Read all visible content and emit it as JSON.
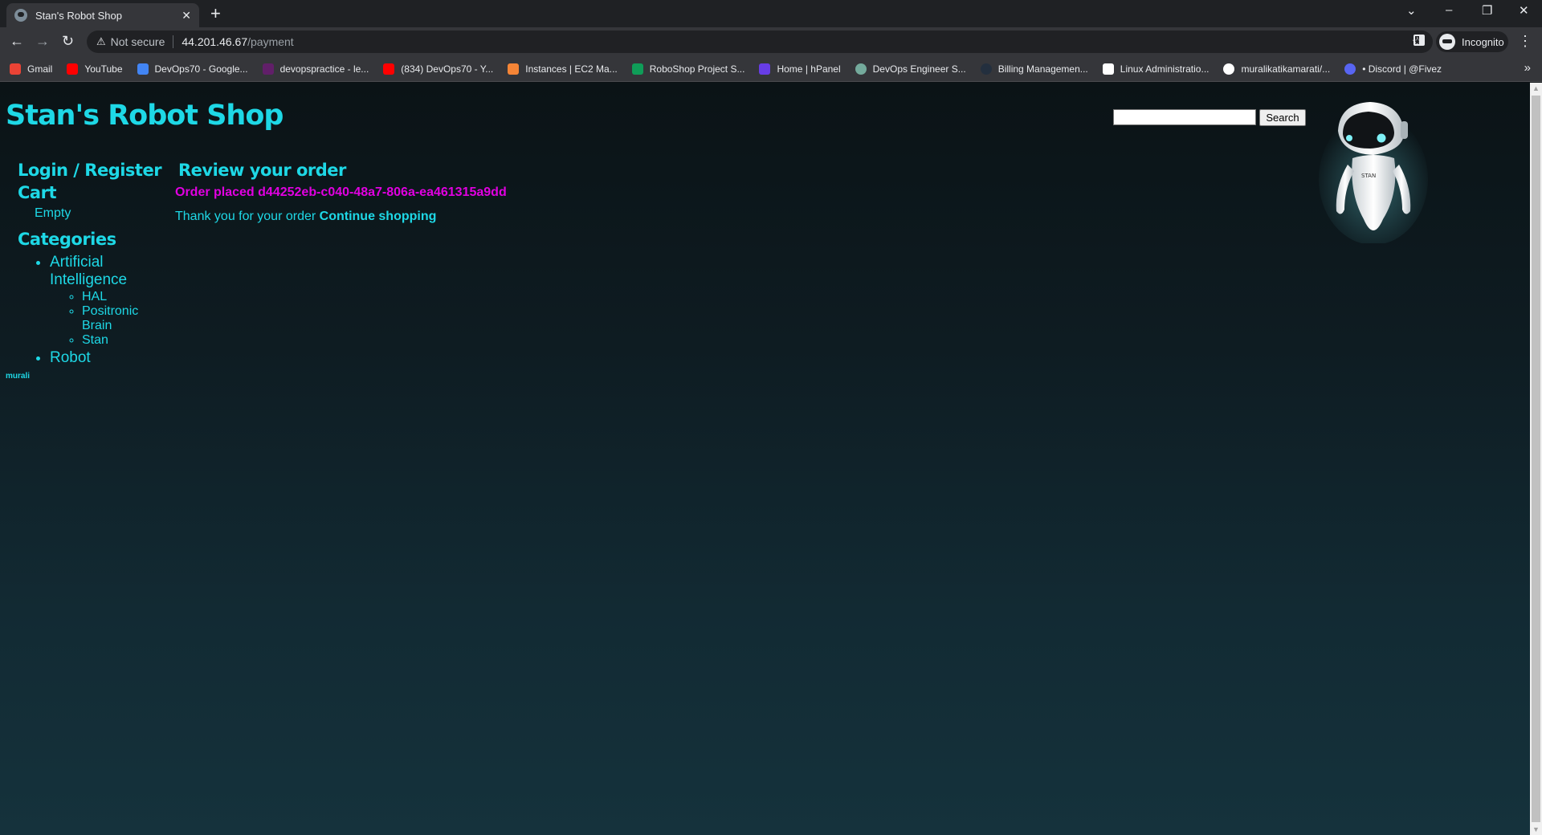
{
  "browser": {
    "tab_title": "Stan's Robot Shop",
    "tab_close": "✕",
    "new_tab": "+",
    "window_controls": [
      "⌄",
      "–",
      "❐",
      "✕"
    ],
    "nav": {
      "back": "←",
      "forward": "→",
      "reload": "↻"
    },
    "address": {
      "security_label": "Not secure",
      "host": "44.201.46.67",
      "path": "/payment"
    },
    "bookmark_star": "☆",
    "profile_label": "Incognito",
    "menu": "⋮",
    "bookmarks": [
      {
        "label": "Gmail",
        "icon": "gmail-icon",
        "color": "#ea4335"
      },
      {
        "label": "YouTube",
        "icon": "youtube-icon",
        "color": "#ff0000"
      },
      {
        "label": "DevOps70 - Google...",
        "icon": "google-docs-icon",
        "color": "#4285f4"
      },
      {
        "label": "devopspractice - le...",
        "icon": "slack-icon",
        "color": "#611f69"
      },
      {
        "label": "(834) DevOps70 - Y...",
        "icon": "youtube-icon",
        "color": "#ff0000"
      },
      {
        "label": "Instances | EC2 Ma...",
        "icon": "aws-ec2-icon",
        "color": "#f58536"
      },
      {
        "label": "RoboShop Project S...",
        "icon": "google-sheets-icon",
        "color": "#0f9d58"
      },
      {
        "label": "Home | hPanel",
        "icon": "hostinger-icon",
        "color": "#673de6"
      },
      {
        "label": "DevOps Engineer S...",
        "icon": "chatgpt-icon",
        "color": "#74aa9c"
      },
      {
        "label": "Billing Managemen...",
        "icon": "aws-icon",
        "color": "#232f3e"
      },
      {
        "label": "Linux Administratio...",
        "icon": "k-logo-icon",
        "color": "#ffffff"
      },
      {
        "label": "muralikatikamarati/...",
        "icon": "github-icon",
        "color": "#ffffff"
      },
      {
        "label": "• Discord | @Fivez",
        "icon": "discord-icon",
        "color": "#5865f2"
      }
    ],
    "bookmarks_overflow": "»"
  },
  "page": {
    "site_title": "Stan's Robot Shop",
    "search": {
      "value": "",
      "button_label": "Search"
    },
    "robot_label": "STAN",
    "sidebar": {
      "login_label": "Login / Register",
      "cart_heading": "Cart",
      "cart_status": "Empty",
      "categories_heading": "Categories",
      "categories": [
        {
          "label": "Artificial Intelligence",
          "items": [
            "HAL",
            "Positronic Brain",
            "Stan"
          ]
        },
        {
          "label": "Robot",
          "items": []
        }
      ]
    },
    "main": {
      "heading": "Review your order",
      "order_message": "Order placed d44252eb-c040-48a7-806a-ea461315a9dd",
      "thanks_text": "Thank you for your order",
      "continue_link": "Continue shopping"
    },
    "footer_user": "murali"
  },
  "colors": {
    "accent": "#1ed8e6",
    "order_highlight": "#e100e1",
    "background_top": "#0b1316",
    "background_bottom": "#15323c"
  }
}
